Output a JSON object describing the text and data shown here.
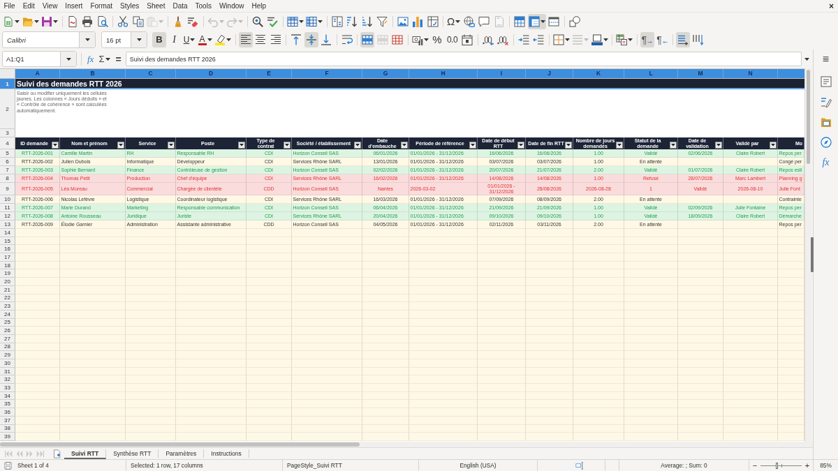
{
  "menu_bar": {
    "items": [
      "File",
      "Edit",
      "View",
      "Insert",
      "Format",
      "Styles",
      "Sheet",
      "Data",
      "Tools",
      "Window",
      "Help"
    ],
    "close_label": "×"
  },
  "standard_toolbar": [
    {
      "on": false,
      "disabled": false
    },
    {
      "on": false,
      "disabled": false
    },
    {
      "on": false,
      "disabled": false
    },
    {
      "on": false,
      "disabled": false
    },
    {
      "on": false,
      "disabled": false
    },
    {
      "on": false,
      "disabled": false
    },
    {
      "on": false,
      "disabled": false
    },
    {
      "on": false,
      "disabled": false
    },
    {
      "on": false,
      "disabled": true
    },
    {
      "on": false,
      "disabled": false
    },
    {
      "on": false,
      "disabled": false
    },
    {
      "on": false,
      "disabled": true
    },
    {
      "on": false,
      "disabled": true
    },
    {
      "on": false,
      "disabled": false
    },
    {
      "on": false,
      "disabled": false
    },
    {
      "on": false,
      "disabled": false
    },
    {
      "on": false,
      "disabled": false
    },
    {
      "on": false,
      "disabled": false
    },
    {
      "on": false,
      "disabled": false
    },
    {
      "on": false,
      "disabled": false
    },
    {
      "on": false,
      "disabled": false
    },
    {
      "on": false,
      "disabled": false
    },
    {
      "on": false,
      "disabled": false
    },
    {
      "on": false,
      "disabled": false
    },
    {
      "label": "Ω",
      "on": false,
      "disabled": false
    },
    {
      "on": false,
      "disabled": false
    },
    {
      "on": false,
      "disabled": false
    },
    {
      "on": false,
      "disabled": true
    },
    {
      "on": false,
      "disabled": false
    },
    {
      "on": true,
      "disabled": false
    },
    {
      "on": false,
      "disabled": false
    },
    {
      "on": false,
      "disabled": false
    }
  ],
  "formatting_toolbar": {
    "font_name": "Calibri",
    "font_size": "16 pt",
    "buttons": [
      {
        "label": "B",
        "on": true,
        "disabled": false
      },
      {
        "label": "I",
        "on": false,
        "disabled": false
      },
      {
        "label": "U",
        "on": false,
        "disabled": false
      },
      {
        "label": "A",
        "on": false,
        "disabled": false
      },
      {
        "on": false,
        "disabled": false
      },
      {
        "on": true,
        "disabled": false
      },
      {
        "on": false,
        "disabled": false
      },
      {
        "on": false,
        "disabled": false
      },
      {
        "on": false,
        "disabled": false
      },
      {
        "on": true,
        "disabled": false
      },
      {
        "on": false,
        "disabled": false
      },
      {
        "on": false,
        "disabled": false
      },
      {
        "on": true,
        "disabled": false
      },
      {
        "on": false,
        "disabled": true
      },
      {
        "on": false,
        "disabled": false
      },
      {
        "on": false,
        "disabled": false
      },
      {
        "label": "%",
        "on": false,
        "disabled": false
      },
      {
        "label": "0.0",
        "on": false,
        "disabled": false
      },
      {
        "on": false,
        "disabled": false
      },
      {
        "on": false,
        "disabled": false
      },
      {
        "on": false,
        "disabled": false
      },
      {
        "on": false,
        "disabled": false
      },
      {
        "on": false,
        "disabled": false
      },
      {
        "on": false,
        "disabled": false
      },
      {
        "on": false,
        "disabled": true
      },
      {
        "on": false,
        "disabled": false
      },
      {
        "on": false,
        "disabled": false
      },
      {
        "label": "¶",
        "on": true,
        "disabled": false
      },
      {
        "label": "¶",
        "on": false,
        "disabled": false
      },
      {
        "on": true,
        "disabled": false
      },
      {
        "on": false,
        "disabled": false
      }
    ]
  },
  "formula_bar": {
    "name_box": "A1:Q1",
    "function_wizard_label": "fx",
    "sum_label": "Σ",
    "formula_label": "=",
    "content": "Suivi des demandes RTT 2026"
  },
  "sidebar": {
    "menu_label": "≡",
    "functions_label": "fx"
  },
  "sheet": {
    "column_headers": [
      {
        "label": "A",
        "selected": true
      },
      {
        "label": "B",
        "selected": true
      },
      {
        "label": "C",
        "selected": true
      },
      {
        "label": "D",
        "selected": true
      },
      {
        "label": "E",
        "selected": true
      },
      {
        "label": "F",
        "selected": true
      },
      {
        "label": "G",
        "selected": true
      },
      {
        "label": "H",
        "selected": true
      },
      {
        "label": "I",
        "selected": true
      },
      {
        "label": "J",
        "selected": true
      },
      {
        "label": "K",
        "selected": true
      },
      {
        "label": "L",
        "selected": true
      },
      {
        "label": "M",
        "selected": true
      },
      {
        "label": "N",
        "selected": true
      }
    ],
    "row_headers": [
      {
        "label": "1",
        "selected": true
      },
      {
        "label": "2",
        "selected": false
      },
      {
        "label": "3",
        "selected": false
      },
      {
        "label": "4",
        "selected": false
      },
      {
        "label": "5",
        "selected": false
      },
      {
        "label": "6",
        "selected": false
      },
      {
        "label": "7",
        "selected": false
      },
      {
        "label": "8",
        "selected": false
      },
      {
        "label": "9",
        "selected": false
      },
      {
        "label": "10",
        "selected": false
      },
      {
        "label": "11",
        "selected": false
      },
      {
        "label": "12",
        "selected": false
      },
      {
        "label": "13",
        "selected": false
      },
      {
        "label": "14",
        "selected": false
      },
      {
        "label": "15",
        "selected": false
      },
      {
        "label": "16",
        "selected": false
      },
      {
        "label": "17",
        "selected": false
      },
      {
        "label": "18",
        "selected": false
      },
      {
        "label": "19",
        "selected": false
      },
      {
        "label": "20",
        "selected": false
      },
      {
        "label": "21",
        "selected": false
      },
      {
        "label": "22",
        "selected": false
      },
      {
        "label": "23",
        "selected": false
      },
      {
        "label": "24",
        "selected": false
      },
      {
        "label": "25",
        "selected": false
      },
      {
        "label": "26",
        "selected": false
      },
      {
        "label": "27",
        "selected": false
      },
      {
        "label": "28",
        "selected": false
      },
      {
        "label": "29",
        "selected": false
      },
      {
        "label": "30",
        "selected": false
      },
      {
        "label": "31",
        "selected": false
      },
      {
        "label": "32",
        "selected": false
      },
      {
        "label": "33",
        "selected": false
      },
      {
        "label": "34",
        "selected": false
      },
      {
        "label": "35",
        "selected": false
      },
      {
        "label": "36",
        "selected": false
      },
      {
        "label": "37",
        "selected": false
      },
      {
        "label": "38",
        "selected": false
      },
      {
        "label": "39",
        "selected": false
      }
    ],
    "title": "Suivi des demandes RTT 2026",
    "note": "Saisir ou modifier uniquement les cellules jaunes. Les colonnes « Jours déduits » et « Contrôle de cohérence » sont calculées automatiquement.",
    "table_columns": [
      {
        "label": "ID demande",
        "filter_button": true
      },
      {
        "label": "Nom et prénom",
        "filter_button": true
      },
      {
        "label": "Service",
        "filter_button": true
      },
      {
        "label": "Poste",
        "filter_button": true
      },
      {
        "label": "Type de contrat",
        "filter_button": true
      },
      {
        "label": "Société / établissement",
        "filter_button": true
      },
      {
        "label": "Date d'embauche",
        "filter_button": true
      },
      {
        "label": "Période de référence",
        "filter_button": true
      },
      {
        "label": "Date de début RTT",
        "filter_button": true
      },
      {
        "label": "Date de fin RTT",
        "filter_button": true
      },
      {
        "label": "Nombre de jours demandés",
        "filter_button": true
      },
      {
        "label": "Statut de la demande",
        "filter_button": true
      },
      {
        "label": "Date de validation",
        "filter_button": true
      },
      {
        "label": "Validé par",
        "filter_button": true
      },
      {
        "label": "Mo",
        "filter_button": false
      }
    ],
    "rows": [
      {
        "kind": "approved",
        "cells": {
          "A": "RTT-2026-001",
          "B": "Camille Martin",
          "C": "RH",
          "D": "Responsable RH",
          "E": "CDI",
          "F": "Horizon Conseil SAS",
          "G": "06/01/2026",
          "H": "01/01/2026 - 31/12/2026",
          "I": "16/06/2026",
          "J": "16/06/2026",
          "K": "1.00",
          "L": "Validé",
          "M": "02/06/2026",
          "N": "Claire Robert",
          "O": "Repos per"
        }
      },
      {
        "kind": "pending",
        "cells": {
          "A": "RTT-2026-002",
          "B": "Julien Dubois",
          "C": "Informatique",
          "D": "Développeur",
          "E": "CDI",
          "F": "Services Rhône SARL",
          "G": "13/01/2026",
          "H": "01/01/2026 - 31/12/2026",
          "I": "03/07/2026",
          "J": "03/07/2026",
          "K": "1.00",
          "L": "En attente",
          "O": "Congé per"
        }
      },
      {
        "kind": "approved",
        "cells": {
          "A": "RTT-2026-003",
          "B": "Sophie Bernard",
          "C": "Finance",
          "D": "Contrôleuse de gestion",
          "E": "CDI",
          "F": "Horizon Conseil SAS",
          "G": "02/02/2026",
          "H": "01/01/2026 - 31/12/2026",
          "I": "20/07/2026",
          "J": "21/07/2026",
          "K": "2.00",
          "L": "Validé",
          "M": "01/07/2026",
          "N": "Claire Robert",
          "O": "Repos esti"
        }
      },
      {
        "kind": "rejected",
        "cells": {
          "A": "RTT-2026-004",
          "B": "Thomas Petit",
          "C": "Production",
          "D": "Chef d'équipe",
          "E": "CDI",
          "F": "Services Rhône SARL",
          "G": "16/02/2026",
          "H": "01/01/2026 - 31/12/2026",
          "I": "14/08/2026",
          "J": "14/08/2026",
          "K": "1.00",
          "L": "Refusé",
          "M": "28/07/2026",
          "N": "Marc Lambert",
          "O": "Planning g"
        }
      },
      {
        "kind": "rejected",
        "cells": {
          "A": "RTT-2026-005",
          "B": "Léa Moreau",
          "C": "Commercial",
          "D": "Chargée de clientèle",
          "E": "CDD",
          "F": "Horizon Conseil SAS",
          "G": "Nantes",
          "H": "2026-03-02",
          "I": "01/01/2026 - 31/12/2026",
          "J": "28/08/2026",
          "K": "2026-08-28",
          "L": "1",
          "M": "Validé",
          "N": "2026-08-10",
          "O": "Julie Font"
        }
      },
      {
        "kind": "pending",
        "cells": {
          "A": "RTT-2026-006",
          "B": "Nicolas Lefèvre",
          "C": "Logistique",
          "D": "Coordinateur logistique",
          "E": "CDI",
          "F": "Services Rhône SARL",
          "G": "16/03/2026",
          "H": "01/01/2026 - 31/12/2026",
          "I": "07/09/2026",
          "J": "08/09/2026",
          "K": "2.00",
          "L": "En attente",
          "O": "Contrainte"
        }
      },
      {
        "kind": "approved",
        "cells": {
          "A": "RTT-2026-007",
          "B": "Marie Durand",
          "C": "Marketing",
          "D": "Responsable communication",
          "E": "CDI",
          "F": "Horizon Conseil SAS",
          "G": "06/04/2026",
          "H": "01/01/2026 - 31/12/2026",
          "I": "21/09/2026",
          "J": "21/09/2026",
          "K": "1.00",
          "L": "Validé",
          "M": "02/09/2026",
          "N": "Julie Fontaine",
          "O": "Repos per"
        }
      },
      {
        "kind": "approved",
        "cells": {
          "A": "RTT-2026-008",
          "B": "Antoine Rousseau",
          "C": "Juridique",
          "D": "Juriste",
          "E": "CDI",
          "F": "Services Rhône SARL",
          "G": "20/04/2026",
          "H": "01/01/2026 - 31/12/2026",
          "I": "09/10/2026",
          "J": "09/10/2026",
          "K": "1.00",
          "L": "Validé",
          "M": "18/09/2026",
          "N": "Claire Robert",
          "O": "Démarche"
        }
      },
      {
        "kind": "pending",
        "cells": {
          "A": "RTT-2026-009",
          "B": "Élodie Garnier",
          "C": "Administration",
          "D": "Assistante administrative",
          "E": "CDD",
          "F": "Horizon Conseil SAS",
          "G": "04/05/2026",
          "H": "01/01/2026 - 31/12/2026",
          "I": "02/11/2026",
          "J": "03/11/2026",
          "K": "2.00",
          "L": "En attente",
          "O": "Repos per"
        }
      }
    ]
  },
  "tab_navigation": {
    "disabled": true
  },
  "sheet_tabs": [
    {
      "label": "Suivi RTT",
      "selected": true
    },
    {
      "label": "Synthèse RTT",
      "selected": false
    },
    {
      "label": "Paramètres",
      "selected": false
    },
    {
      "label": "Instructions",
      "selected": false
    }
  ],
  "status_bar": {
    "sheet_position": "Sheet 1 of 4",
    "selection": "Selected: 1 row, 17 columns",
    "page_style": "PageStyle_Suivi RTT",
    "language": "English (USA)",
    "summary": "Average: ; Sum: 0",
    "zoom_out_label": "−",
    "zoom_slider": {
      "level": 0.39
    },
    "zoom_in_label": "+",
    "zoom": "85%"
  }
}
